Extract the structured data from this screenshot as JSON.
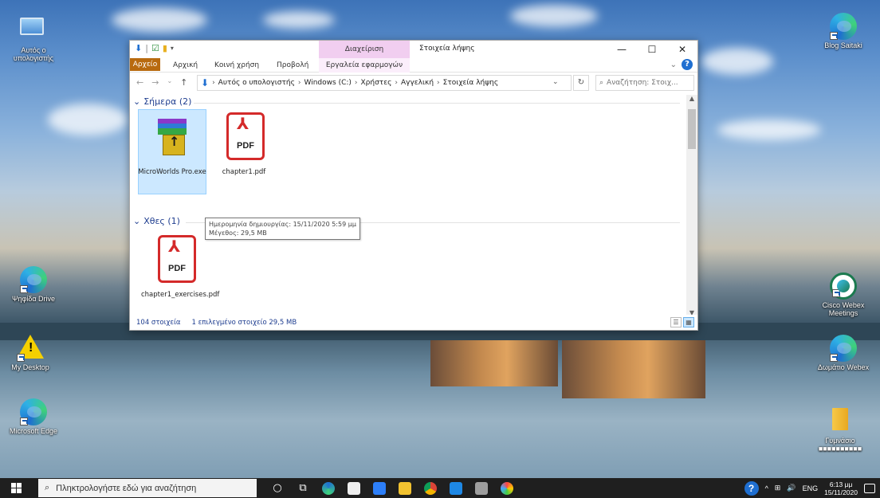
{
  "desktop": {
    "icons": [
      {
        "label": "Αυτός ο υπολογιστής"
      },
      {
        "label": "Ψηφίδα Drive"
      },
      {
        "label": "My Desktop"
      },
      {
        "label": "Microsoft Edge"
      },
      {
        "label": "Blog Saitaki"
      },
      {
        "label": "Cisco Webex Meetings"
      },
      {
        "label": "Δωμάτιο Webex"
      },
      {
        "label": "Γυμνάσιο ■■■■■■■■■■"
      }
    ]
  },
  "window": {
    "contextual_header": "Διαχείριση",
    "title": "Στοιχεία λήψης",
    "controls": {
      "minimize": "—",
      "maximize": "☐",
      "close": "✕"
    },
    "ribbon_tabs": [
      "Αρχείο",
      "Αρχική",
      "Κοινή χρήση",
      "Προβολή",
      "Εργαλεία εφαρμογών"
    ],
    "breadcrumb": [
      "Αυτός ο υπολογιστής",
      "Windows (C:)",
      "Χρήστες",
      "Αγγελική",
      "Στοιχεία λήψης"
    ],
    "search_placeholder": "Αναζήτηση: Στοιχ...",
    "groups": [
      {
        "header": "Σήμερα (2)",
        "files": [
          {
            "name": "MicroWorlds Pro.exe",
            "type": "exe",
            "selected": true
          },
          {
            "name": "chapter1.pdf",
            "type": "pdf",
            "selected": false
          }
        ]
      },
      {
        "header": "Χθες (1)",
        "files": [
          {
            "name": "chapter1_exercises.pdf",
            "type": "pdf",
            "selected": false
          }
        ]
      }
    ],
    "tooltip": {
      "created": "Ημερομηνία δημιουργίας: 15/11/2020 5:59 μμ",
      "size": "Μέγεθος: 29,5 MB"
    },
    "status": {
      "count": "104 στοιχεία",
      "selected": "1 επιλεγμένο στοιχείο  29,5 MB"
    },
    "pdf_label": "PDF"
  },
  "taskbar": {
    "search_placeholder": "Πληκτρολογήστε εδώ για αναζήτηση",
    "language": "ENG",
    "time": "6:13 μμ",
    "date": "15/11/2020"
  },
  "colors": {
    "file_tab": "#b86a0f",
    "contextual": "#f1cef0",
    "selection": "#cce8ff",
    "accent": "#1f6fd1",
    "pdf_red": "#d42a2a"
  }
}
